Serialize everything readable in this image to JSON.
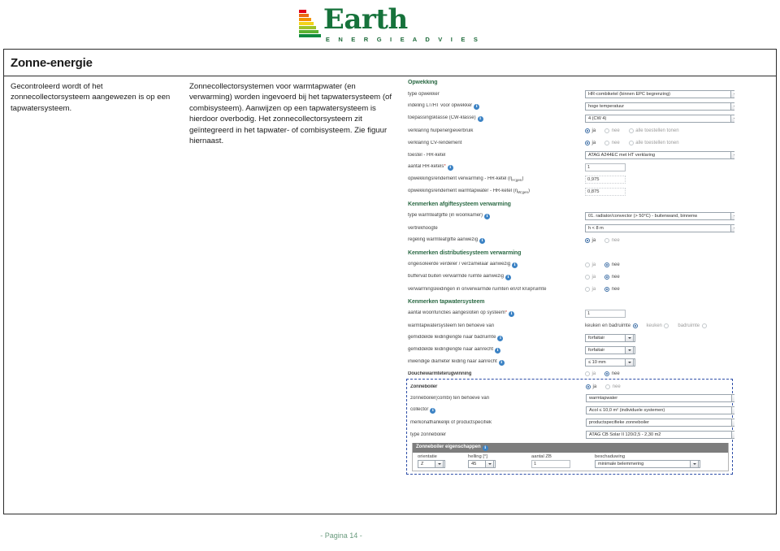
{
  "brand": {
    "name": "Earth",
    "tagline": "E N E R G I E   A D V I E S",
    "bar_colors": [
      "#0e8a3e",
      "#5cb232",
      "#9ec328",
      "#f3d31a",
      "#f39200",
      "#ea6b12",
      "#e2001a"
    ],
    "green": "#16723b"
  },
  "page": {
    "title": "Zonne-energie",
    "column_left": "Gecontroleerd wordt of het zonnecollectorsysteem aangewezen is op een tapwatersysteem.",
    "column_right": "Zonnecollectorsystemen voor warmtapwater (en verwarming) worden ingevoerd bij het tapwatersysteem (of combisysteem). Aanwijzen op een tapwatersysteem is hierdoor overbodig. Het zonnecollectorsysteem zit geïntegreerd in het tapwater- of combisysteem. Zie figuur hiernaast.",
    "footer": "- Pagina 14 -"
  },
  "form": {
    "sections": {
      "opwekking": "Opwekking",
      "afgifte": "Kenmerken afgiftesysteem verwarming",
      "distributie": "Kenmerken distributiesysteem verwarming",
      "tapwater": "Kenmerken tapwatersysteem",
      "dwtw": "Douchewarmteterugwinning",
      "zonneboiler": "Zonneboiler",
      "zb_props": "Zonneboiler eigenschappen"
    },
    "labels": {
      "type_opwekker": "type opwekker",
      "indeling_ltht": "indeling LT/HT voor opwekker",
      "toepassingsklasse": "toepassingsklasse (CW-klasse)",
      "verklaring_hulpenergie": "verklaring hulpenergieverbruik",
      "verklaring_cv": "verklaring CV-rendement",
      "toestel_hr": "toestel - HR-ketel",
      "aantal_hr": "aantal HR-ketels",
      "rend_verwarming": "opwekkingsrendement verwarming - HR-ketel (η",
      "rend_verwarming_sub": "H;gen",
      "rend_tapwater": "opwekkingsrendement warmtapwater - HR-ketel (η",
      "rend_tapwater_sub": "W;gen",
      "type_warmteafgifte": "type warmteafgifte (in woonkamer)",
      "vertrekhoogte": "vertrekhoogte",
      "regeling_warmteafgifte": "regeling warmteafgifte aanwezig",
      "ongeisoleerde_verdeler": "ongeisoleerde verdeler / verzamelaar aanwezig",
      "buffervat": "buffervat buiten verwarmde ruimte aanwezig",
      "verwarmingsleidingen": "verwarmingsleidingen in onverwarmde ruimten en/of kruipruimte",
      "aantal_woonfuncties": "aantal woonfuncties aangesloten op systeem",
      "wtw_systeem_tbv": "warmtapwatersysteem ten behoeve van",
      "leidinglengte_bad": "gemiddelde leidinglengte naar badruimte",
      "leidinglengte_aanrecht": "gemiddelde leidinglengte naar aanrecht",
      "diameter_aanrecht": "inwendige diameter leiding naar aanrecht",
      "zb_tbv": "zonneboiler(combi) ten behoeve van",
      "collector": "collector",
      "merkonafhankelijk": "merkonafhankelijk of productspecifiek",
      "type_zonneboiler": "type zonneboiler"
    },
    "values": {
      "type_opwekker": "HR-combiketel (binnen EPC begrenzing)",
      "indeling_ltht": "hoge temperatuur",
      "toepassingsklasse": "4 (CW 4)",
      "toestel_hr": "ATAG A244EC met HT verklaring",
      "aantal_hr": "1",
      "rend_verwarming": "0,975",
      "rend_tapwater": "0,875",
      "type_warmteafgifte": "01. radiator/convector (> 50°C) - buitenwand, binnenw",
      "vertrekhoogte": "h < 8 m",
      "aantal_woonfuncties": "1",
      "leidinglengte_bad": "forfaitair",
      "leidinglengte_aanrecht": "forfaitair",
      "diameter_aanrecht": "≤ 10 mm",
      "zb_tbv": "warmtapwater",
      "collector": "Acol ≤ 10,0 m² (individuele systemen)",
      "merkonafhankelijk": "productspecifieke zonneboiler",
      "type_zonneboiler": "ATAG CB Solar II 120/2,5 - 2,30 m2"
    },
    "radio_labels": {
      "ja": "ja",
      "nee": "nee",
      "alle_toestellen": "alle toestellen tonen",
      "keuken_en_badruimte": "keuken en badruimte",
      "keuken": "keuken",
      "badruimte": "badruimte"
    },
    "radio_state": {
      "verklaring_hulpenergie": "ja",
      "verklaring_cv": "ja",
      "regeling_warmteafgifte": "ja",
      "ongeisoleerde_verdeler": "nee",
      "buffervat": "nee",
      "verwarmingsleidingen": "nee",
      "wtw_systeem_tbv": "keuken en badruimte",
      "dwtw": "nee",
      "zonneboiler": "ja"
    },
    "zb_props": {
      "columns": [
        "orientatie",
        "helling [°]",
        "aantal ZB",
        "beschaduwing"
      ],
      "values": [
        "Z",
        "45",
        "1",
        "minimale belemmering"
      ]
    }
  }
}
